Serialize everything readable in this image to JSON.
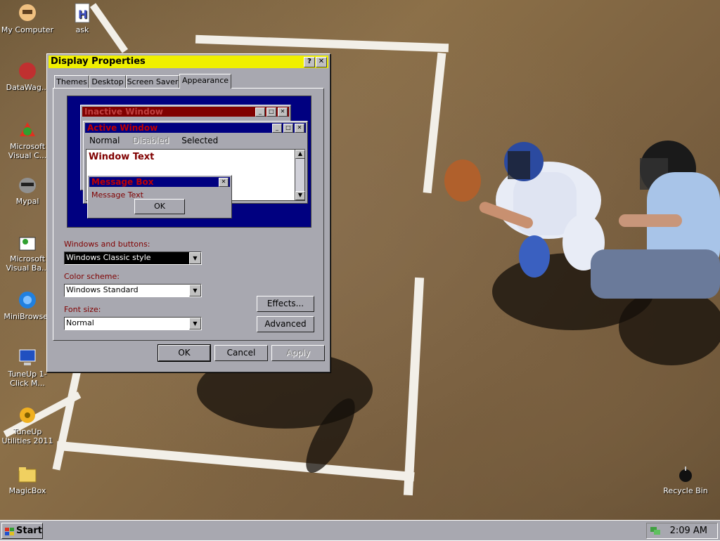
{
  "desktop": {
    "icons": [
      {
        "label": "My Computer"
      },
      {
        "label": "ask"
      },
      {
        "label": "DataWag..."
      },
      {
        "label": "Microsoft Visual C..."
      },
      {
        "label": "Mypal"
      },
      {
        "label": "Microsoft Visual Ba..."
      },
      {
        "label": "MiniBrowser"
      },
      {
        "label": "TuneUp 1-Click M..."
      },
      {
        "label": "TuneUp Utilities 2011"
      },
      {
        "label": "MagicBox"
      },
      {
        "label": "Recycle Bin"
      }
    ]
  },
  "dialog": {
    "title": "Display Properties",
    "help_btn": "?",
    "close_btn": "✕",
    "tabs": [
      "Themes",
      "Desktop",
      "Screen Saver",
      "Appearance"
    ],
    "active_tab": "Appearance",
    "preview": {
      "inactive_title": "Inactive Window",
      "active_title": "Active Window",
      "menu": [
        "Normal",
        "Disabled",
        "Selected"
      ],
      "window_text": "Window Text",
      "msgbox_title": "Message Box",
      "msgbox_text": "Message Text",
      "msgbox_ok": "OK"
    },
    "windows_buttons_label": "Windows and buttons:",
    "windows_buttons_value": "Windows Classic style",
    "color_scheme_label": "Color scheme:",
    "color_scheme_value": "Windows Standard",
    "font_size_label": "Font size:",
    "font_size_value": "Normal",
    "effects_btn": "Effects...",
    "advanced_btn": "Advanced",
    "ok_btn": "OK",
    "cancel_btn": "Cancel",
    "apply_btn": "Apply"
  },
  "taskbar": {
    "start_label": "Start",
    "clock": "2:09 AM"
  },
  "colors": {
    "active_title": "#000080",
    "inactive_title": "#800000",
    "dialog_title": "#f0f000",
    "window_face": "#a8a8b0"
  }
}
